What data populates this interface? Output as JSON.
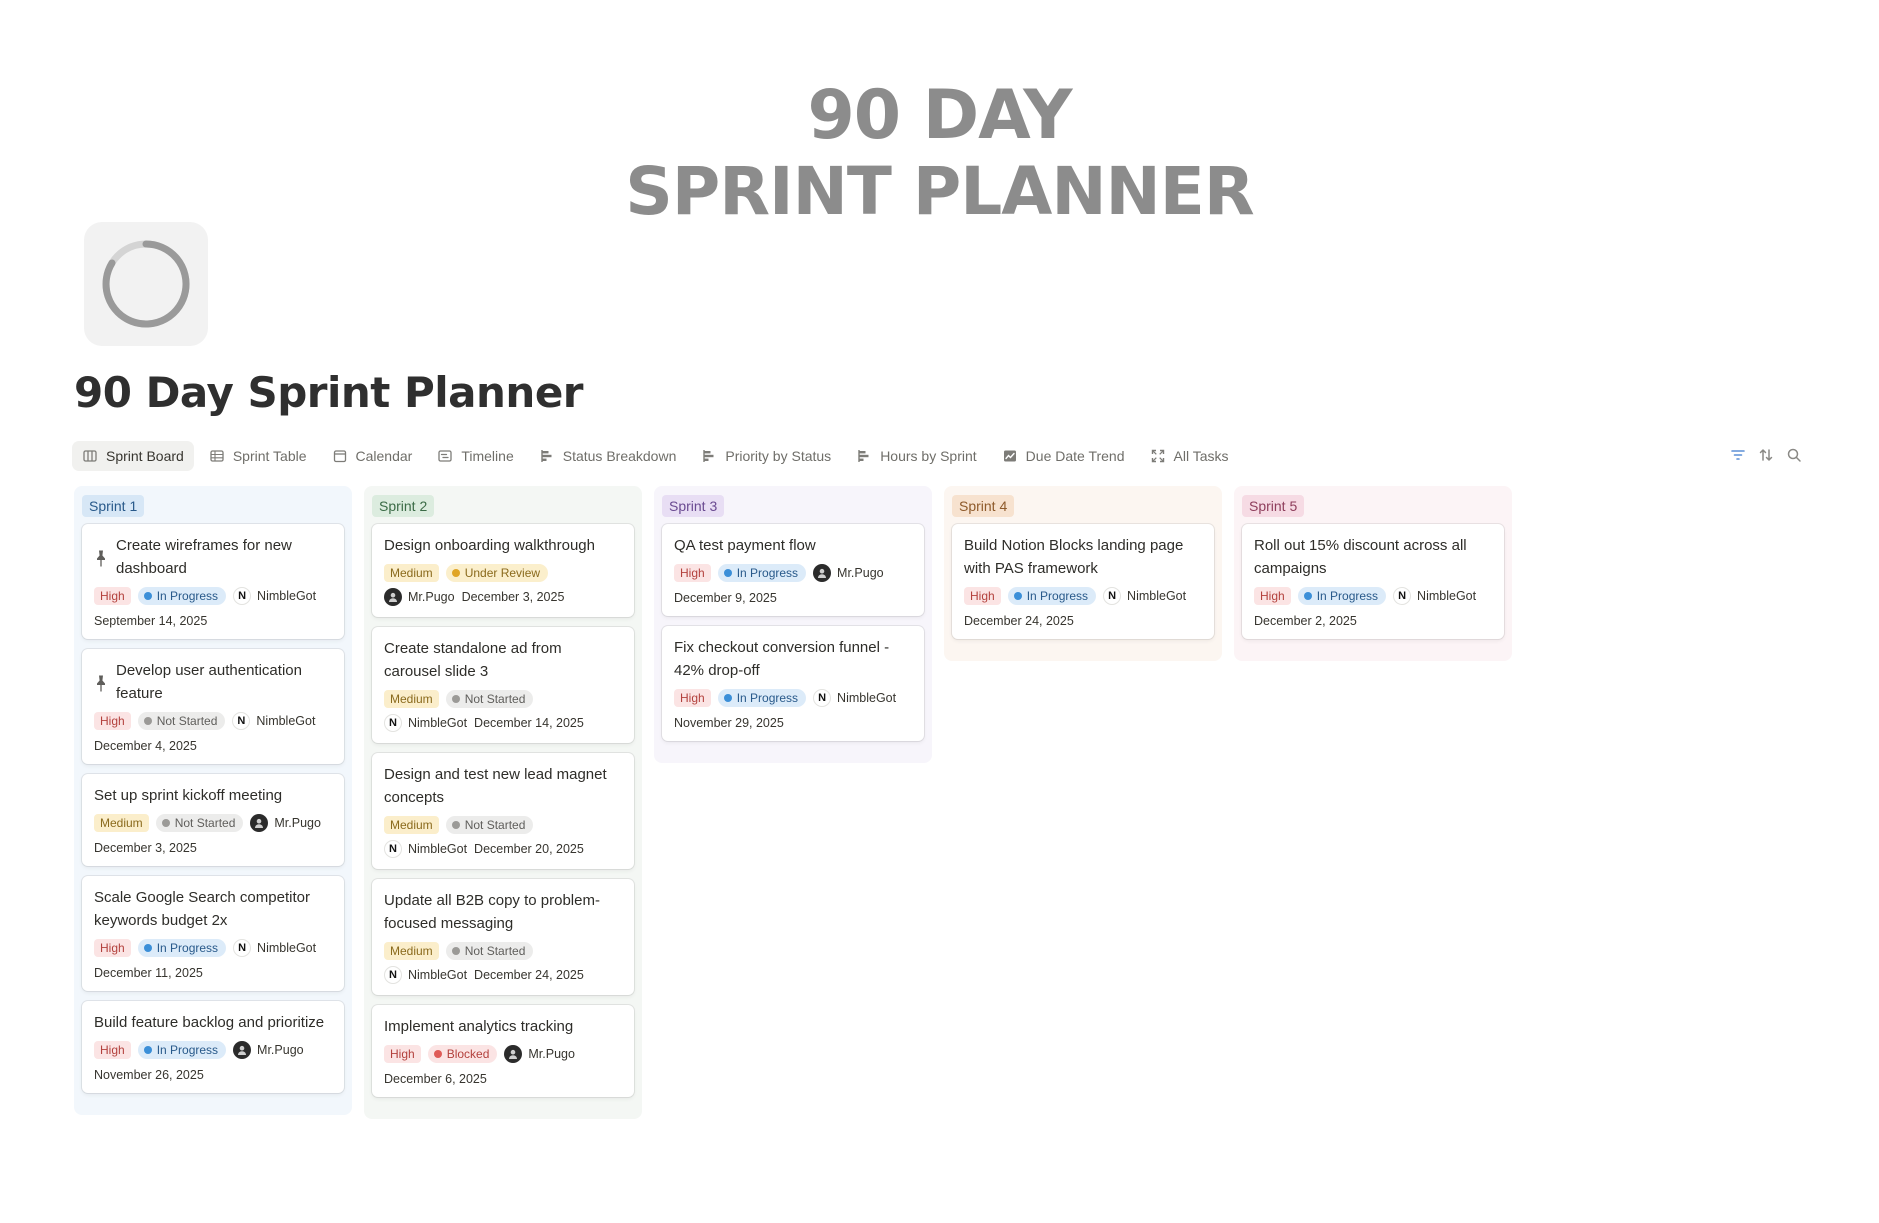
{
  "cover": {
    "line1": "90 DAY",
    "line2": "SPRINT PLANNER"
  },
  "page": {
    "title": "90 Day Sprint Planner"
  },
  "tabs": [
    {
      "label": "Sprint Board",
      "icon": "board-icon",
      "active": true
    },
    {
      "label": "Sprint Table",
      "icon": "table-icon"
    },
    {
      "label": "Calendar",
      "icon": "calendar-icon"
    },
    {
      "label": "Timeline",
      "icon": "timeline-icon"
    },
    {
      "label": "Status Breakdown",
      "icon": "bar-chart-icon"
    },
    {
      "label": "Priority by Status",
      "icon": "bar-chart-icon"
    },
    {
      "label": "Hours by Sprint",
      "icon": "bar-chart-icon"
    },
    {
      "label": "Due Date Trend",
      "icon": "line-chart-icon"
    },
    {
      "label": "All Tasks",
      "icon": "expand-icon"
    }
  ],
  "tools": [
    "filter-icon",
    "sort-icon",
    "search-icon"
  ],
  "colors": {
    "priority": {
      "High": {
        "bg": "#fbe4e4",
        "fg": "#b3413d"
      },
      "Medium": {
        "bg": "#fbeecb",
        "fg": "#8a6a1c"
      }
    },
    "status": {
      "In Progress": {
        "bg": "#dcebf9",
        "fg": "#28598a",
        "dot": "#3b8fd8"
      },
      "Not Started": {
        "bg": "#ececeb",
        "fg": "#5f5e5b",
        "dot": "#9b9a97"
      },
      "Under Review": {
        "bg": "#fbefcc",
        "fg": "#8a6a1c",
        "dot": "#e0a526"
      },
      "Blocked": {
        "bg": "#fbe4e4",
        "fg": "#b3413d",
        "dot": "#df5b57"
      }
    }
  },
  "columns": [
    {
      "label": "Sprint 1",
      "bg": "#f2f7fc",
      "tag_bg": "#d7e7f6",
      "tag_fg": "#28598a",
      "cards": [
        {
          "title": "Create wireframes for new dashboard",
          "pinned": true,
          "priority": "High",
          "status": "In Progress",
          "assignee": "NimbleGot",
          "date": "September 14, 2025"
        },
        {
          "title": "Develop user authentication feature",
          "pinned": true,
          "priority": "High",
          "status": "Not Started",
          "assignee": "NimbleGot",
          "date": "December 4, 2025"
        },
        {
          "title": "Set up sprint kickoff meeting",
          "priority": "Medium",
          "status": "Not Started",
          "assignee": "Mr.Pugo",
          "date": "December 3, 2025"
        },
        {
          "title": "Scale Google Search competitor keywords budget 2x",
          "priority": "High",
          "status": "In Progress",
          "assignee": "NimbleGot",
          "date": "December 11, 2025"
        },
        {
          "title": "Build feature backlog and prioritize",
          "priority": "High",
          "status": "In Progress",
          "assignee": "Mr.Pugo",
          "date": "November 26, 2025"
        }
      ]
    },
    {
      "label": "Sprint 2",
      "bg": "#f4f7f4",
      "tag_bg": "#dcecdf",
      "tag_fg": "#3b6b46",
      "cards": [
        {
          "title": "Design onboarding walkthrough",
          "priority": "Medium",
          "status": "Under Review",
          "assignee": "Mr.Pugo",
          "date": "December 3, 2025",
          "inline_date": true
        },
        {
          "title": "Create standalone ad from carousel slide 3",
          "priority": "Medium",
          "status": "Not Started",
          "assignee": "NimbleGot",
          "date": "December 14, 2025",
          "inline_date": true
        },
        {
          "title": "Design and test new lead magnet concepts",
          "priority": "Medium",
          "status": "Not Started",
          "assignee": "NimbleGot",
          "date": "December 20, 2025",
          "inline_date": true
        },
        {
          "title": "Update all B2B copy to problem-focused messaging",
          "priority": "Medium",
          "status": "Not Started",
          "assignee": "NimbleGot",
          "date": "December 24, 2025",
          "inline_date": true
        },
        {
          "title": "Implement analytics tracking",
          "priority": "High",
          "status": "Blocked",
          "assignee": "Mr.Pugo",
          "date": "December 6, 2025"
        }
      ]
    },
    {
      "label": "Sprint 3",
      "bg": "#f7f5fb",
      "tag_bg": "#e8def4",
      "tag_fg": "#6a4a91",
      "cards": [
        {
          "title": "QA test payment flow",
          "priority": "High",
          "status": "In Progress",
          "assignee": "Mr.Pugo",
          "date": "December 9, 2025"
        },
        {
          "title": "Fix checkout conversion funnel - 42% drop-off",
          "priority": "High",
          "status": "In Progress",
          "assignee": "NimbleGot",
          "date": "November 29, 2025"
        }
      ]
    },
    {
      "label": "Sprint 4",
      "bg": "#fcf6f1",
      "tag_bg": "#f7e2cf",
      "tag_fg": "#8e5a2a",
      "cards": [
        {
          "title": "Build Notion Blocks landing page with PAS framework",
          "priority": "High",
          "status": "In Progress",
          "assignee": "NimbleGot",
          "date": "December 24, 2025"
        }
      ]
    },
    {
      "label": "Sprint 5",
      "bg": "#fcf4f6",
      "tag_bg": "#f6dbe4",
      "tag_fg": "#8f3e5c",
      "cards": [
        {
          "title": "Roll out 15% discount across all campaigns",
          "priority": "High",
          "status": "In Progress",
          "assignee": "NimbleGot",
          "date": "December 2, 2025"
        }
      ]
    }
  ]
}
